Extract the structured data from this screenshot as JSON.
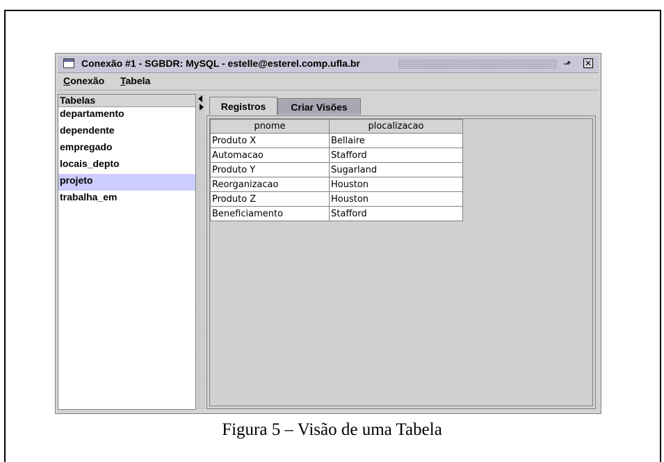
{
  "window": {
    "title": "Conexão #1 - SGBDR: MySQL - estelle@esterel.comp.ufla.br",
    "restore_icon": "restore-icon",
    "close_icon": "close-icon"
  },
  "menubar": {
    "items": [
      {
        "label_first": "C",
        "label_rest": "onexão"
      },
      {
        "label_first": "T",
        "label_rest": "abela"
      }
    ]
  },
  "sidebar": {
    "header": "Tabelas",
    "items": [
      {
        "label": "departamento"
      },
      {
        "label": "dependente"
      },
      {
        "label": "empregado"
      },
      {
        "label": "locais_depto"
      },
      {
        "label": "projeto"
      },
      {
        "label": "trabalha_em"
      }
    ],
    "selected": "projeto",
    "selection_color": "#ccccff"
  },
  "tabs": [
    {
      "label": "Registros",
      "active": true
    },
    {
      "label": "Criar Visões",
      "active": false
    }
  ],
  "grid": {
    "columns": [
      "pnome",
      "plocalizacao"
    ],
    "rows": [
      [
        "Produto X",
        "Bellaire"
      ],
      [
        "Automacao",
        "Stafford"
      ],
      [
        "Produto Y",
        "Sugarland"
      ],
      [
        "Reorganizacao",
        "Houston"
      ],
      [
        "Produto Z",
        "Houston"
      ],
      [
        "Beneficiamento",
        "Stafford"
      ]
    ]
  },
  "caption": "Figura 5 – Visão de uma Tabela"
}
